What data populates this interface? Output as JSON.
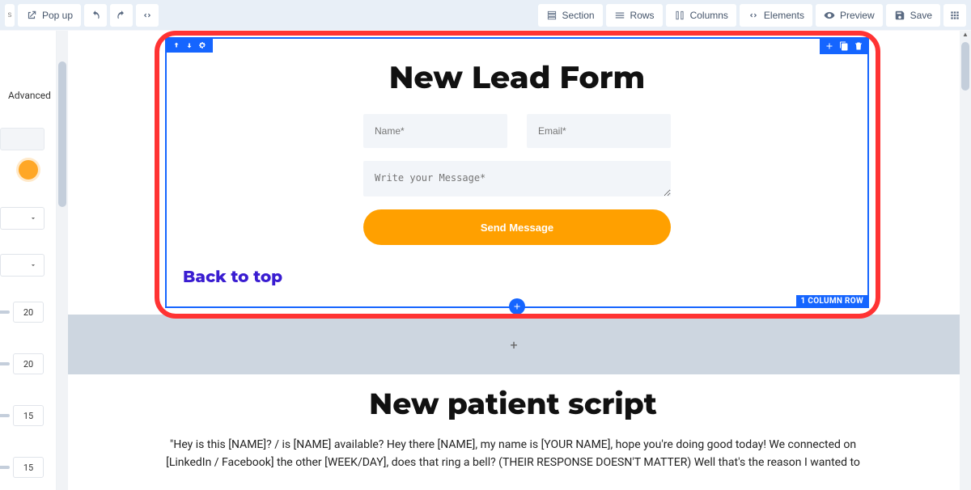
{
  "topbar": {
    "popup_label": "Pop up",
    "section_label": "Section",
    "rows_label": "Rows",
    "columns_label": "Columns",
    "elements_label": "Elements",
    "preview_label": "Preview",
    "save_label": "Save"
  },
  "sidebar": {
    "tab_advanced": "Advanced",
    "values": {
      "v1": "20",
      "v2": "20",
      "v3": "15",
      "v4": "15"
    },
    "colors": {
      "swatch": "#ffa726"
    }
  },
  "section": {
    "label": "1 COLUMN ROW",
    "title": "New Lead Form",
    "name_placeholder": "Name*",
    "email_placeholder": "Email*",
    "message_placeholder": "Write your Message*",
    "send_label": "Send Message",
    "back_link": "Back to top"
  },
  "second_section": {
    "title": "New patient script",
    "body": "\"Hey is this [NAME]? / is [NAME] available? Hey there [NAME], my name is [YOUR NAME], hope you're doing good today! We connected on [LinkedIn / Facebook] the other [WEEK/DAY], does that ring a bell? (THEIR RESPONSE DOESN'T MATTER) Well that's the reason I wanted to"
  }
}
